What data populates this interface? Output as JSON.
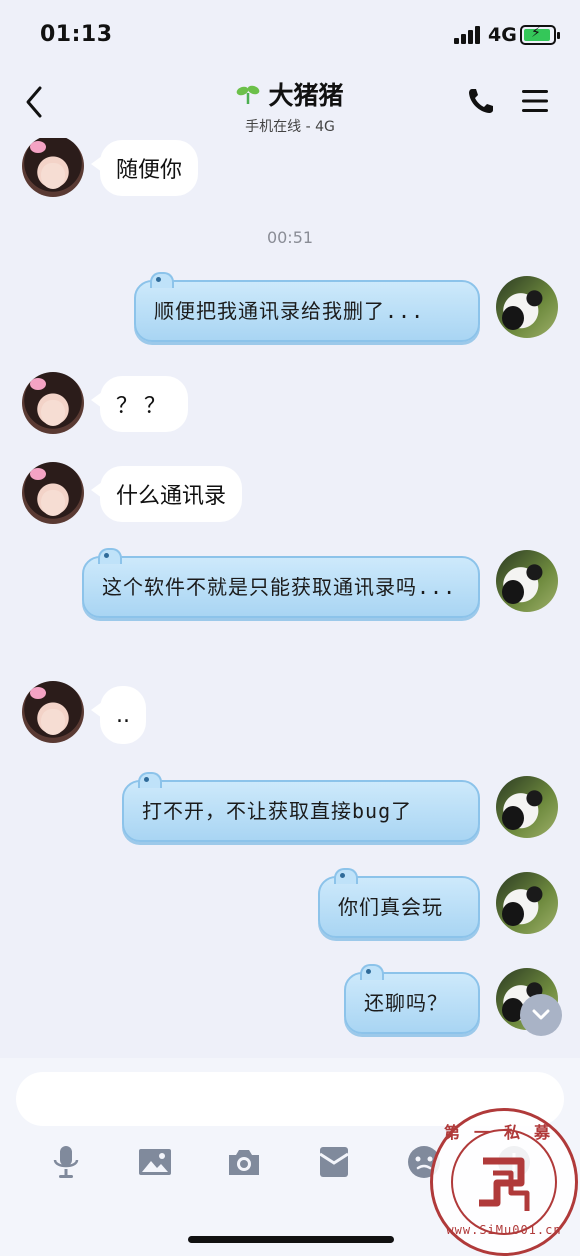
{
  "status_bar": {
    "time": "01:13",
    "network": "4G"
  },
  "header": {
    "contact_name": "大猪猪",
    "status": "手机在线 - 4G"
  },
  "messages": [
    {
      "side": "left",
      "text": "随便你"
    },
    {
      "side": "time",
      "text": "00:51"
    },
    {
      "side": "right",
      "text": "顺便把我通讯录给我删了..."
    },
    {
      "side": "left",
      "text": "？？"
    },
    {
      "side": "left",
      "text": "什么通讯录"
    },
    {
      "side": "right",
      "text": "这个软件不就是只能获取通讯录吗..."
    },
    {
      "side": "left",
      "text": ".."
    },
    {
      "side": "right",
      "text": "打不开，不让获取直接bug了"
    },
    {
      "side": "right",
      "text": "你们真会玩"
    },
    {
      "side": "right",
      "text": "还聊吗？"
    }
  ],
  "input": {
    "placeholder": ""
  },
  "toolbar": [
    "microphone-icon",
    "image-icon",
    "camera-icon",
    "red-envelope-icon",
    "emoji-icon",
    "plus-icon"
  ],
  "watermark": {
    "top": "第一私募",
    "bottom": "www.SiMu001.cn"
  },
  "colors": {
    "bubble_blue": "#b9def7",
    "bubble_border": "#8cc3ea",
    "page_bg": "#eef0f9",
    "watermark": "#b03a3a"
  }
}
